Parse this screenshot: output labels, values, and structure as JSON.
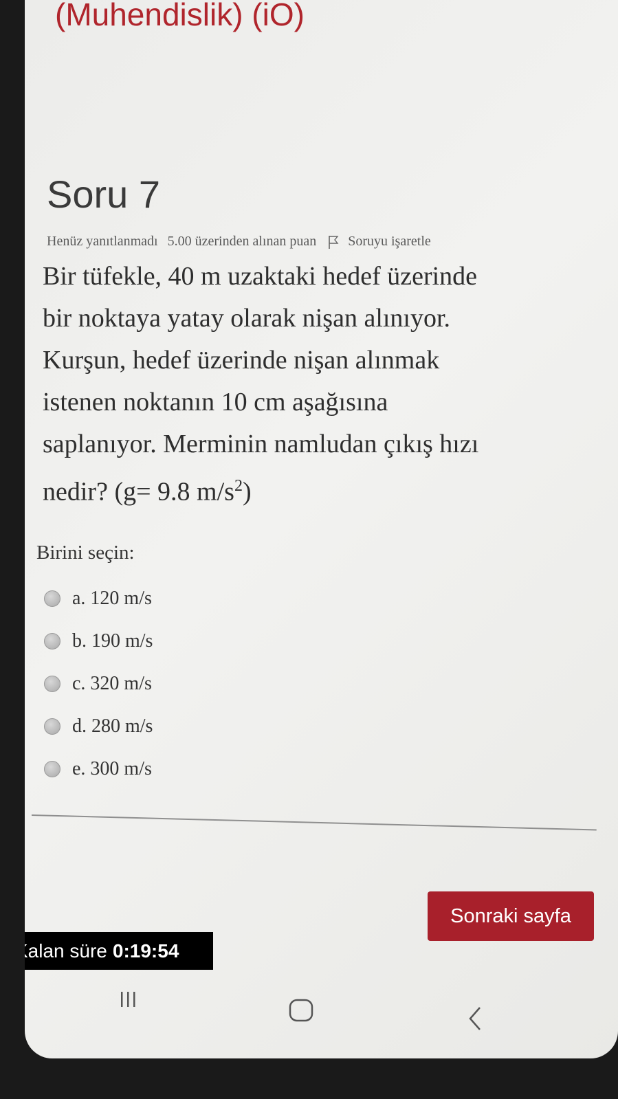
{
  "course_title": "(Muhendislik) (iO)",
  "question": {
    "heading": "Soru 7",
    "status": "Henüz yanıtlanmadı",
    "points": "5.00 üzerinden alınan puan",
    "flag_label": "Soruyu işaretle",
    "lines": [
      "Bir tüfekle, 40 m uzaktaki hedef üzerinde",
      "bir noktaya yatay olarak nişan alınıyor.",
      "Kurşun, hedef üzerinde nişan alınmak",
      "istenen noktanın 10 cm aşağısına",
      "saplanıyor. Merminin namludan çıkış hızı"
    ],
    "last_line_prefix": "nedir? (g= 9.8 m/s",
    "last_line_sup": "2",
    "last_line_suffix": ")"
  },
  "choose_label": "Birini seçin:",
  "options": [
    {
      "label": "a. 120 m/s"
    },
    {
      "label": "b. 190 m/s"
    },
    {
      "label": "c. 320 m/s"
    },
    {
      "label": "d. 280 m/s"
    },
    {
      "label": "e. 300 m/s"
    }
  ],
  "next_button": "Sonraki sayfa",
  "timer": {
    "label": "Kalan süre",
    "value": "0:19:54"
  },
  "nav": {
    "recents_icon": "recents-icon",
    "home_icon": "home-icon",
    "back_icon": "back-icon"
  },
  "colors": {
    "accent": "#a8202b",
    "title": "#b0252c"
  }
}
